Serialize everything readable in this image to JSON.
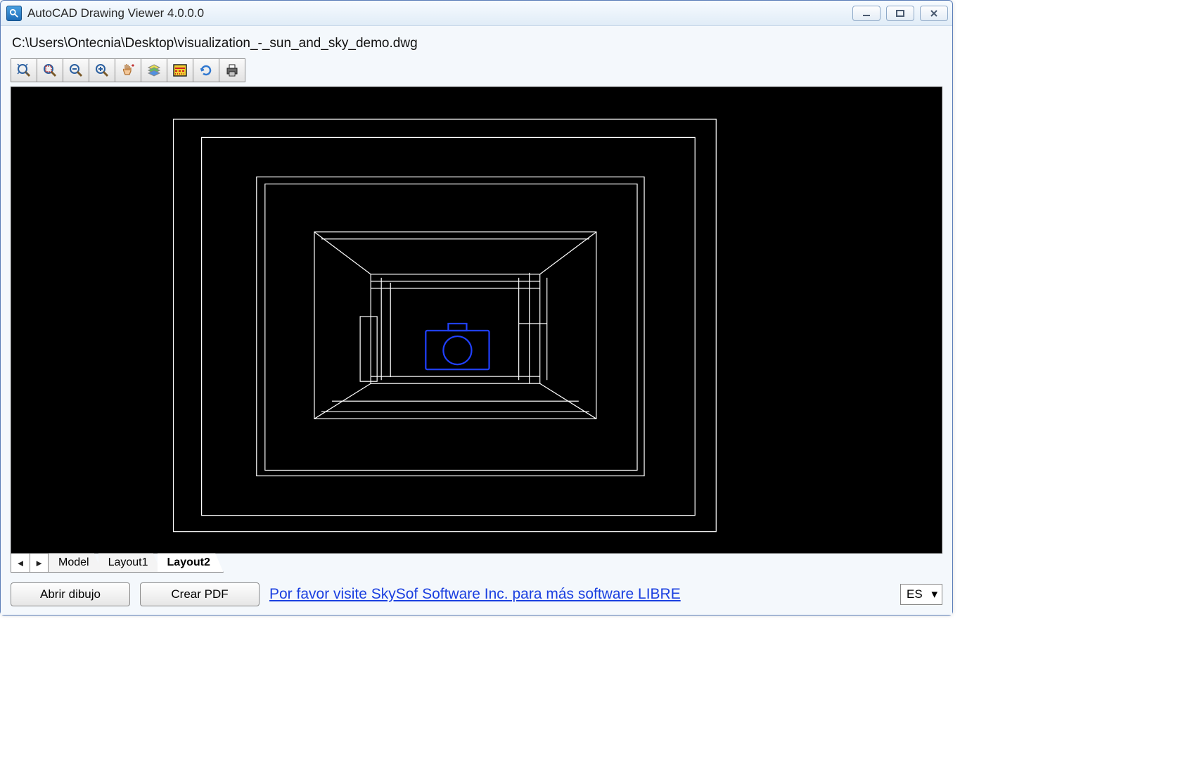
{
  "window": {
    "title": "AutoCAD Drawing Viewer 4.0.0.0"
  },
  "file": {
    "path": "C:\\Users\\Ontecnia\\Desktop\\visualization_-_sun_and_sky_demo.dwg"
  },
  "toolbar": {
    "items": [
      "zoom-extents",
      "zoom-window",
      "zoom-out",
      "zoom-in",
      "pan",
      "layers",
      "linetype",
      "regen",
      "print"
    ]
  },
  "tabs": {
    "items": [
      {
        "label": "Model",
        "active": false
      },
      {
        "label": "Layout1",
        "active": false
      },
      {
        "label": "Layout2",
        "active": true
      }
    ]
  },
  "buttons": {
    "open": "Abrir dibujo",
    "pdf": "Crear PDF"
  },
  "link": {
    "text": "Por favor visite SkySof Software Inc. para más software LIBRE"
  },
  "language": {
    "selected": "ES"
  }
}
